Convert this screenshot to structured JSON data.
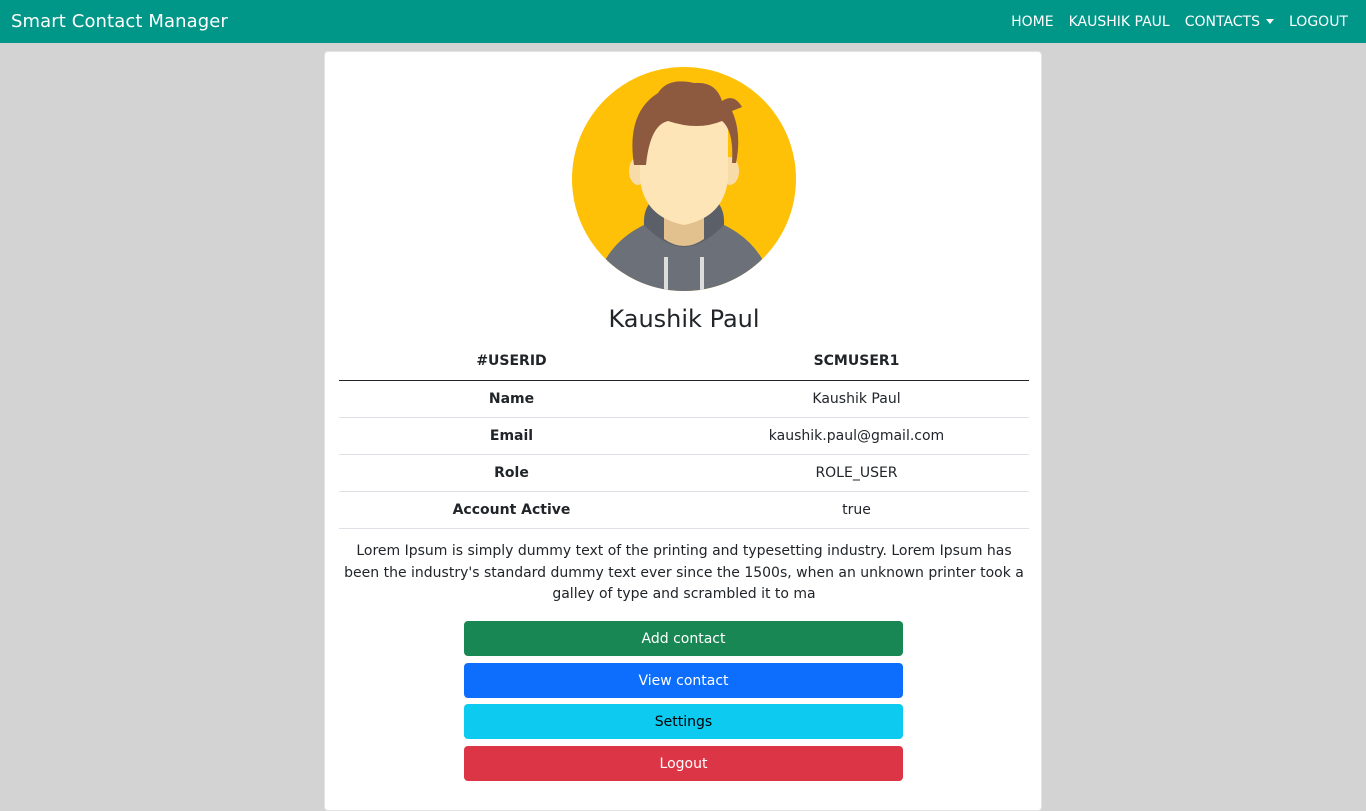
{
  "navbar": {
    "brand": "Smart Contact Manager",
    "links": [
      "HOME",
      "KAUSHIK PAUL",
      "CONTACTS",
      "LOGOUT"
    ]
  },
  "profile": {
    "avatar_icon": "user-avatar-icon",
    "name": "Kaushik Paul",
    "table": {
      "header": [
        "#USERID",
        "SCMUSER1"
      ],
      "rows": [
        [
          "Name",
          "Kaushik Paul"
        ],
        [
          "Email",
          "kaushik.paul@gmail.com"
        ],
        [
          "Role",
          "ROLE_USER"
        ],
        [
          "Account Active",
          "true"
        ]
      ]
    },
    "description": "Lorem Ipsum is simply dummy text of the printing and typesetting industry. Lorem Ipsum has been the industry's standard dummy text ever since the 1500s, when an unknown printer took a galley of type and scrambled it to ma"
  },
  "buttons": {
    "add": "Add contact",
    "view": "View contact",
    "settings": "Settings",
    "logout": "Logout"
  },
  "colors": {
    "navbar": "#009688",
    "add": "#198754",
    "view": "#0d6efd",
    "settings": "#0dcaf0",
    "logout": "#dc3545"
  }
}
